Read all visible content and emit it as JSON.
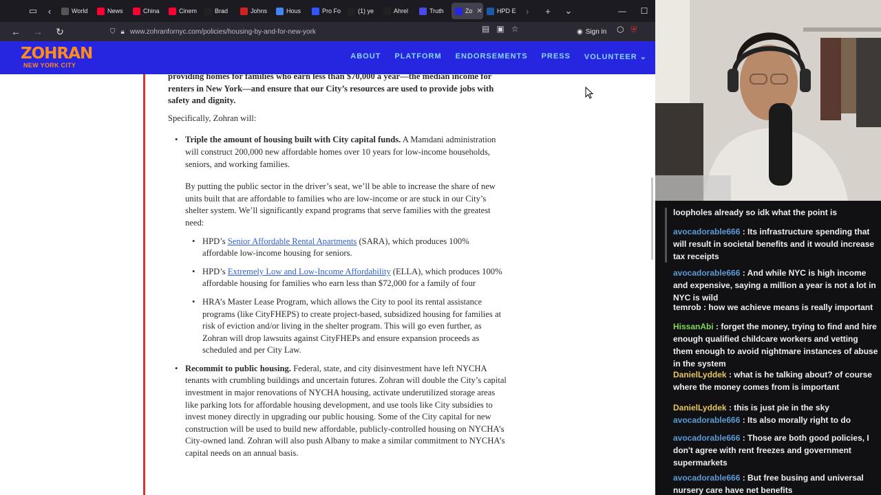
{
  "browser": {
    "tabs": [
      {
        "label": "World",
        "icon": "page-icon",
        "color": "#555"
      },
      {
        "label": "News",
        "icon": "youtube-icon",
        "color": "#ff0033"
      },
      {
        "label": "China",
        "icon": "youtube-icon",
        "color": "#ff0033"
      },
      {
        "label": "Cinem",
        "icon": "youtube-icon",
        "color": "#ff0033"
      },
      {
        "label": "Brad",
        "icon": "x-icon",
        "color": "#222"
      },
      {
        "label": "Johns",
        "icon": "p-icon",
        "color": "#d32020"
      },
      {
        "label": "Hous",
        "icon": "google-icon",
        "color": "#4285f4"
      },
      {
        "label": "Pro Fo",
        "icon": "play-icon",
        "color": "#3355ff"
      },
      {
        "label": "(1) ye",
        "icon": "x-icon",
        "color": "#222"
      },
      {
        "label": "Ahrel",
        "icon": "tiktok-icon",
        "color": "#222"
      },
      {
        "label": "Truth",
        "icon": "t-icon",
        "color": "#4a4ae8"
      },
      {
        "label": "Zo",
        "icon": "z-icon",
        "color": "#2626e0",
        "active": true
      },
      {
        "label": "HPD E",
        "icon": "hpd-icon",
        "color": "#1a5aa8"
      }
    ],
    "url": "www.zohranfornyc.com/policies/housing-by-and-for-new-york",
    "sign_in": "Sign in"
  },
  "site": {
    "logo_line1": "ZOHRAN",
    "logo_line2": "NEW YORK CITY",
    "nav": [
      "ABOUT",
      "PLATFORM",
      "ENDORSEMENTS",
      "PRESS",
      "VOLUNTEER"
    ]
  },
  "article": {
    "intro": "providing homes for families who earn less than $70,000 a year—the median income for renters in New York—and ensure that our City’s resources are used to provide jobs with safety and dignity.",
    "specifically": "Specifically, Zohran will:",
    "b1_title": "Triple the amount of housing built with City capital funds.",
    "b1_text": " A Mamdani administration will construct 200,000 new affordable homes over 10 years for low-income households, seniors, and working families.",
    "b1_para": "By putting the public sector in the driver’s seat, we’ll be able to increase the share of new units built that are affordable to families who are low-income or are stuck in our City’s shelter system. We’ll significantly expand programs that serve families with the greatest need:",
    "s1_pre": "HPD’s ",
    "s1_link": "Senior Affordable Rental Apartments",
    "s1_post": " (SARA), which produces 100% affordable low-income housing for seniors.",
    "s2_pre": "HPD’s ",
    "s2_link": "Extremely Low and Low-Income Affordability",
    "s2_post": " (ELLA), which produces 100% affordable housing for families who earn less than $72,000 for a family of four",
    "s3": "HRA’s Master Lease Program, which allows the City to pool its rental assistance programs (like CityFHEPS) to create project-based, subsidized housing for families at risk of eviction and/or living in the shelter program. This will go even further, as Zohran will drop lawsuits against CityFHEPs and ensure expansion proceeds as scheduled and per City Law.",
    "b2_title": "Recommit to public housing.",
    "b2_text": " Federal, state, and city disinvestment have left NYCHA tenants with crumbling buildings and uncertain futures. Zohran will double the City’s capital investment in major renovations of NYCHA housing, activate underutilized storage areas like parking lots for affordable housing development, and use tools like City subsidies to invest money directly in upgrading our public housing. Some of the City capital for new construction will be used to build new affordable, publicly-controlled housing on NYCHA’s City-owned land. Zohran will also push Albany to make a similar commitment to NYCHA’s capital needs on an annual basis."
  },
  "chat": [
    {
      "user": "",
      "text": "loopholes already so idk what the point is",
      "color": "#efeff1"
    },
    {
      "user": "avocadorable666",
      "text": " : Its infrastructure spending that will result in societal benefits and it would increase tax receipts",
      "color": "#5b9bd5"
    },
    {
      "user": "avocadorable666",
      "text": " : And while NYC is high income and expensive, saying a million a year is not a lot in NYC is wild",
      "color": "#5b9bd5"
    },
    {
      "user": "temrob",
      "text": " : how we achieve means is really important",
      "color": "#efeff1"
    },
    {
      "user": "HissanAbi",
      "text": " : forget the money, trying to find and hire enough qualified childcare workers and vetting them enough to avoid nightmare instances of abuse in the system",
      "color": "#7ed957"
    },
    {
      "user": "DanielLyddek",
      "text": " : what is he talking about? of course where the money comes from is important",
      "color": "#e8c35a"
    },
    {
      "user": "DanielLyddek",
      "text": " : this is just pie in the sky",
      "color": "#e8c35a"
    },
    {
      "user": "avocadorable666",
      "text": " : Its also morally right to do",
      "color": "#5b9bd5"
    },
    {
      "user": "avocadorable666",
      "text": " : Those are both good policies, I don't agree with rent freezes and government supermarkets",
      "color": "#5b9bd5"
    },
    {
      "user": "avocadorable666",
      "text": " : But free busing and universal nursery care have net benefits",
      "color": "#5b9bd5"
    }
  ]
}
